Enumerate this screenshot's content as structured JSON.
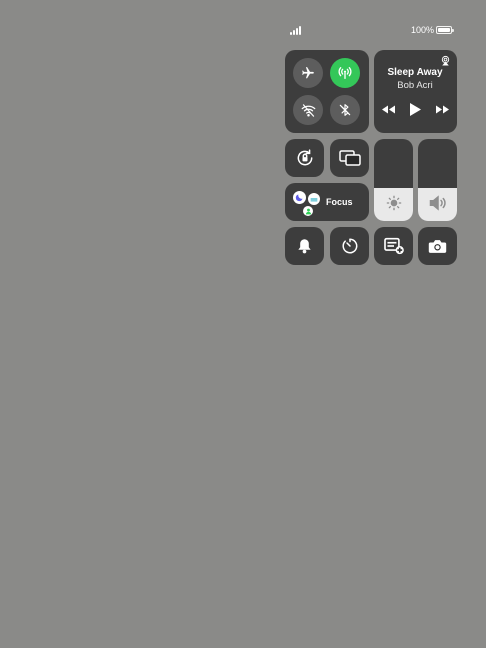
{
  "status_bar": {
    "battery_percent": "100%",
    "signal_icon": "cellular-signal-icon",
    "battery_icon": "battery-icon"
  },
  "connectivity": {
    "airplane": {
      "icon": "airplane-icon",
      "on": false
    },
    "cellular": {
      "icon": "cellular-antenna-icon",
      "on": true,
      "color": "#34c759"
    },
    "wifi": {
      "icon": "wifi-off-icon",
      "on": false
    },
    "bluetooth": {
      "icon": "bluetooth-off-icon",
      "on": false
    }
  },
  "now_playing": {
    "title": "Sleep Away",
    "artist": "Bob Acri",
    "airplay_icon": "airplay-icon",
    "controls": [
      "rewind-icon",
      "play-icon",
      "fast-forward-icon"
    ]
  },
  "controls": {
    "rotation_lock_icon": "rotation-lock-icon",
    "screen_mirroring_icon": "screen-mirroring-icon",
    "focus_label": "Focus",
    "focus_icons": [
      "moon-icon",
      "bed-icon",
      "person-icon"
    ],
    "brightness": {
      "icon": "sun-icon",
      "level": 0.4
    },
    "volume": {
      "icon": "speaker-icon",
      "level": 0.4
    }
  },
  "bottom_row": [
    {
      "icon": "bell-icon"
    },
    {
      "icon": "timer-icon"
    },
    {
      "icon": "quick-note-icon"
    },
    {
      "icon": "camera-icon"
    }
  ]
}
